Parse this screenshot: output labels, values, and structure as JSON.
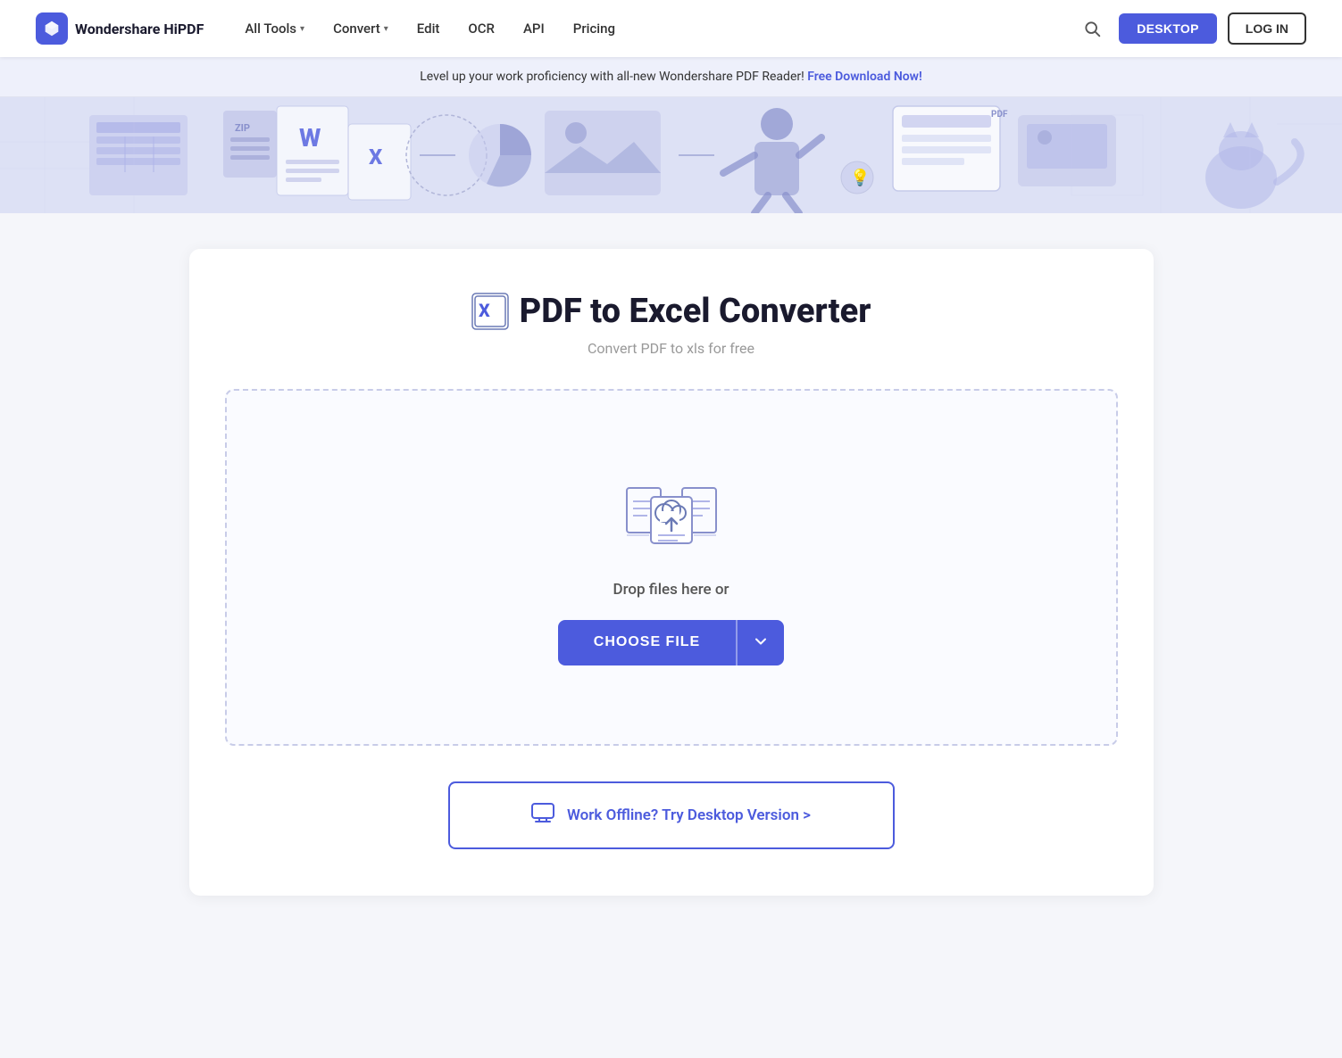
{
  "navbar": {
    "logo_text": "Wondershare HiPDF",
    "nav_items": [
      {
        "label": "All Tools",
        "has_dropdown": true
      },
      {
        "label": "Convert",
        "has_dropdown": true
      },
      {
        "label": "Edit",
        "has_dropdown": false
      },
      {
        "label": "OCR",
        "has_dropdown": false
      },
      {
        "label": "API",
        "has_dropdown": false
      },
      {
        "label": "Pricing",
        "has_dropdown": false
      }
    ],
    "desktop_btn": "DESKTOP",
    "login_btn": "LOG IN"
  },
  "banner": {
    "text": "Level up your work proficiency with all-new Wondershare PDF Reader!",
    "link_text": "Free Download Now!"
  },
  "converter": {
    "title": "PDF to Excel Converter",
    "subtitle": "Convert PDF to xls for free",
    "drop_text": "Drop files here or",
    "choose_file_btn": "CHOOSE FILE",
    "offline_text": "Work Offline? Try Desktop Version >"
  }
}
